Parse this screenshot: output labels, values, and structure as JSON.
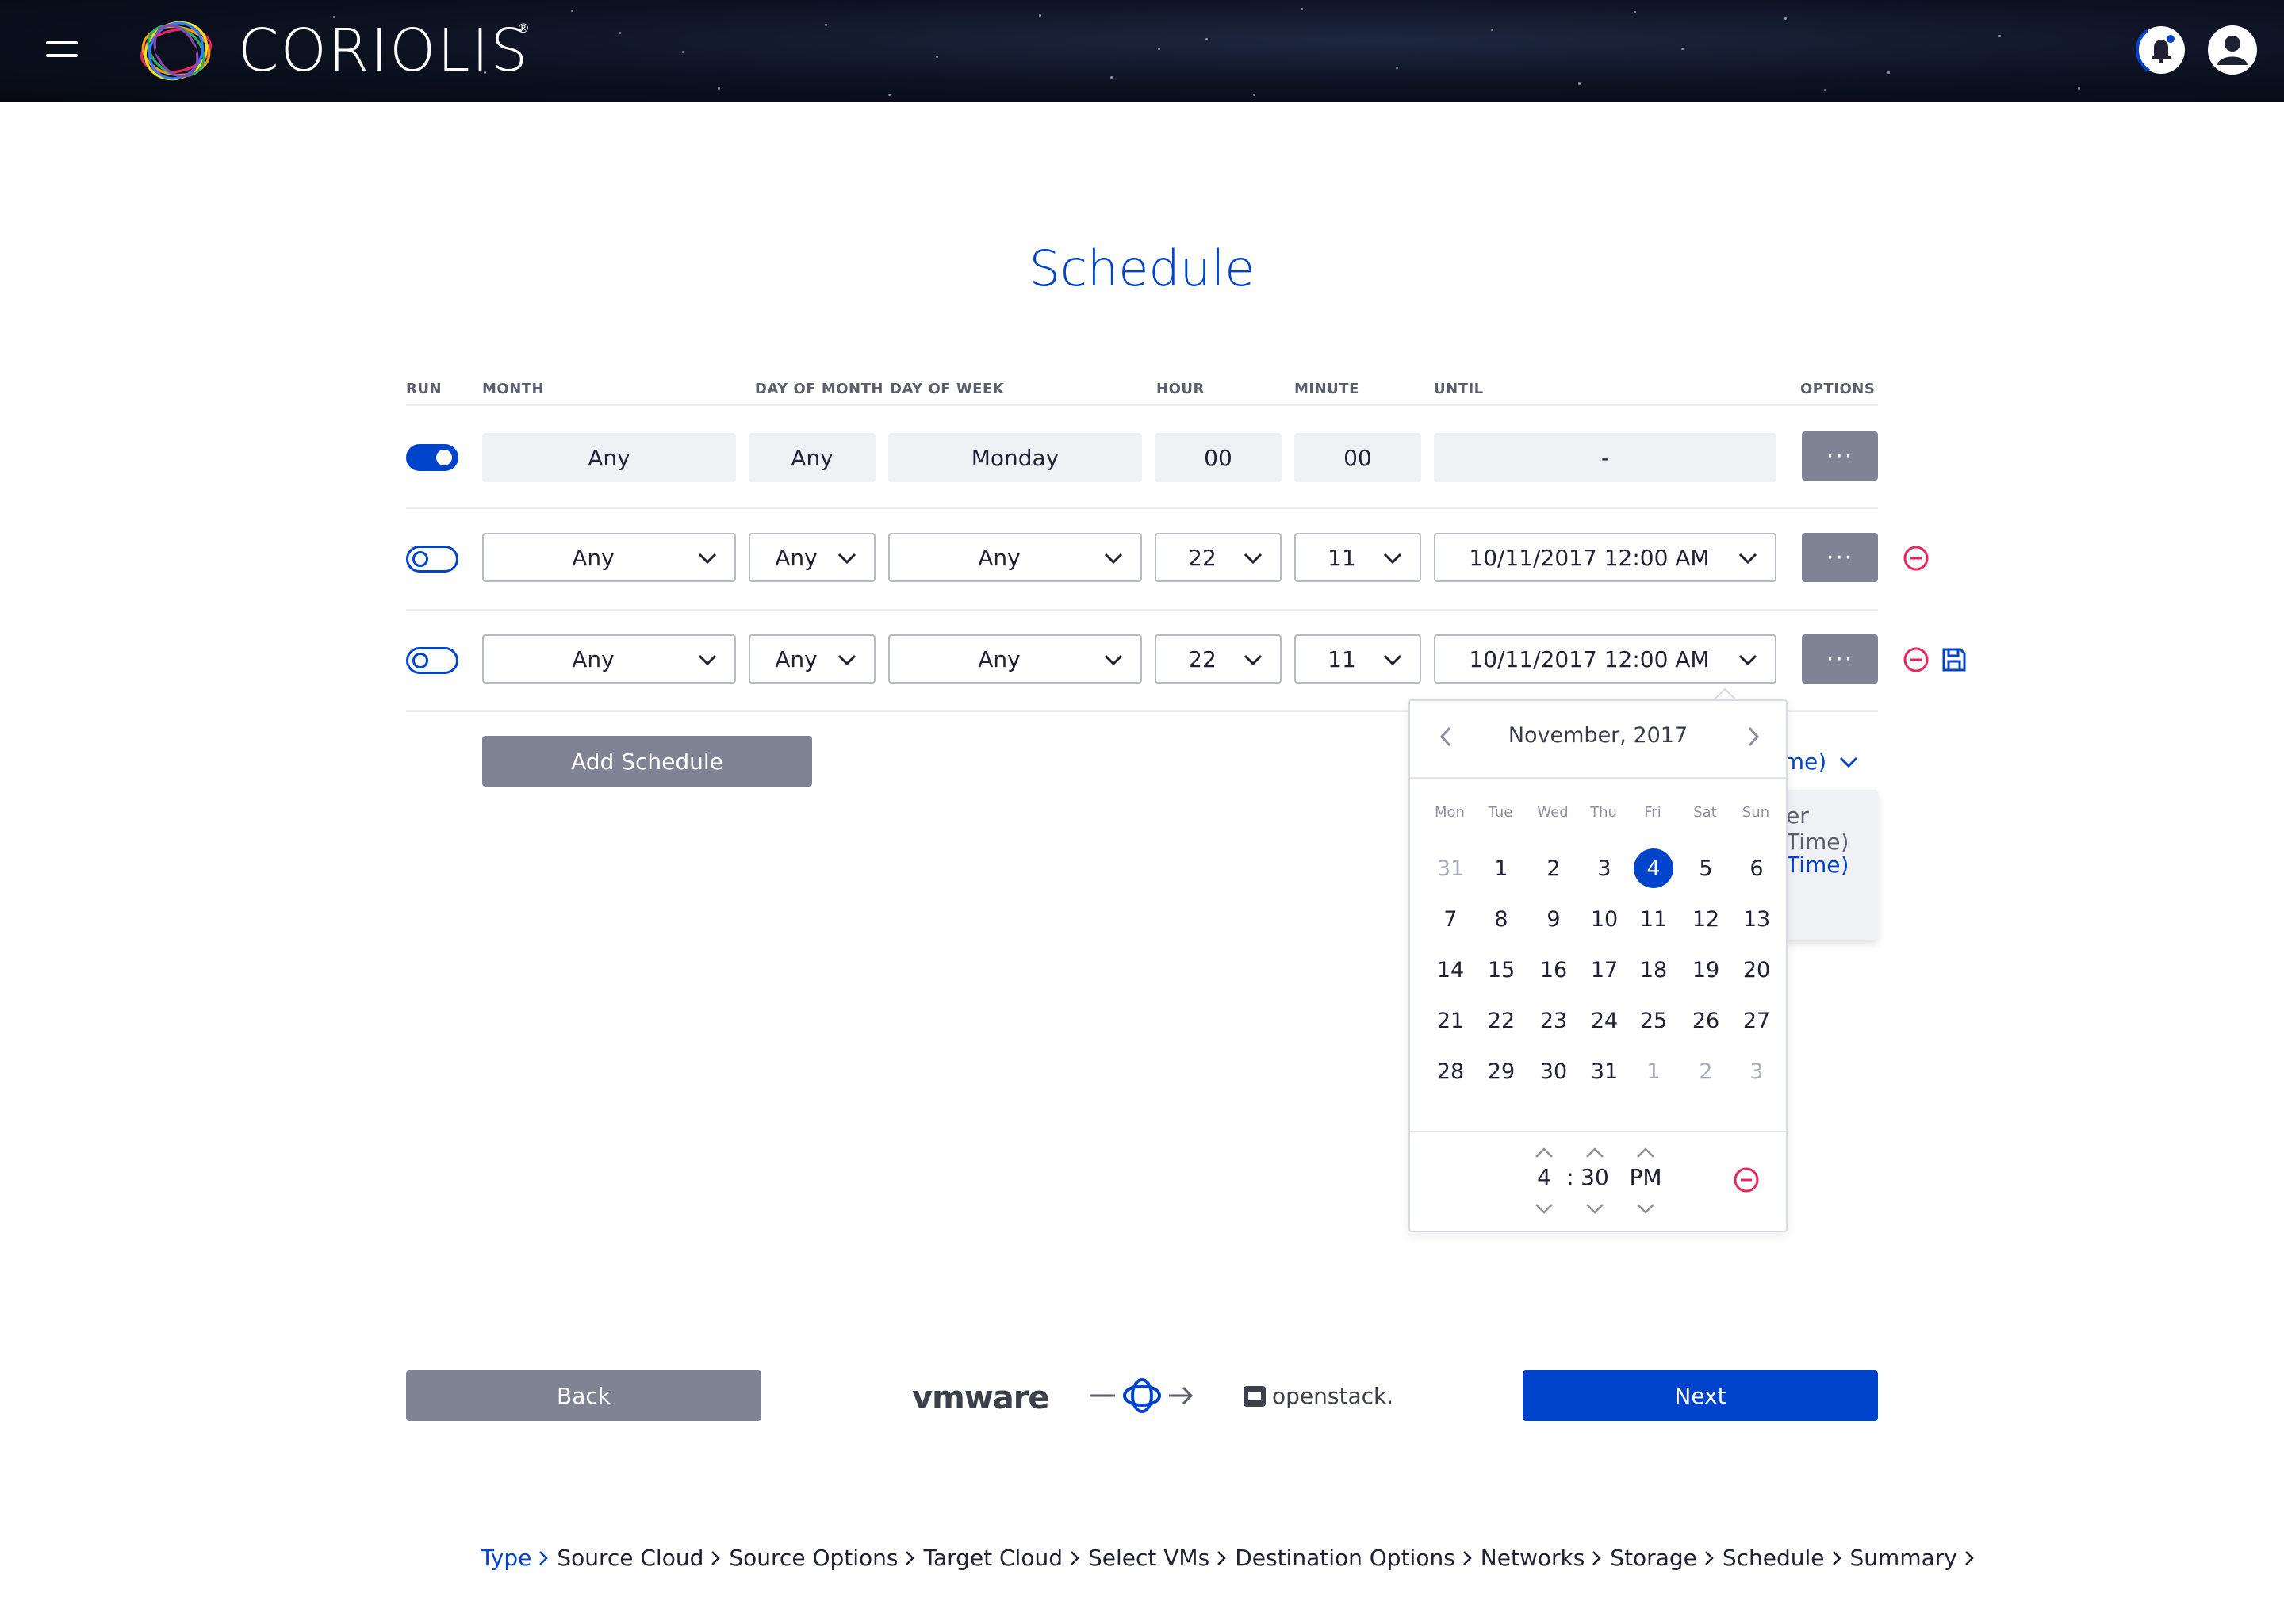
{
  "app": {
    "logo_text": "CORIOLIS",
    "logo_reg": "®"
  },
  "page": {
    "title": "Schedule"
  },
  "table": {
    "headers": {
      "run": "RUN",
      "month": "MONTH",
      "day_of_month": "DAY OF MONTH",
      "day_of_week": "DAY OF WEEK",
      "hour": "HOUR",
      "minute": "MINUTE",
      "until": "UNTIL",
      "options": "OPTIONS"
    },
    "rows": [
      {
        "run_on": true,
        "month": "Any",
        "day_of_month": "Any",
        "day_of_week": "Monday",
        "hour": "00",
        "minute": "00",
        "until": "-",
        "options_label": "···"
      },
      {
        "run_on": false,
        "month": "Any",
        "day_of_month": "Any",
        "day_of_week": "Any",
        "hour": "22",
        "minute": "11",
        "until": "10/11/2017 12:00 AM",
        "options_label": "···"
      },
      {
        "run_on": false,
        "month": "Any",
        "day_of_month": "Any",
        "day_of_week": "Any",
        "hour": "22",
        "minute": "11",
        "until": "10/11/2017 12:00 AM",
        "options_label": "···"
      }
    ],
    "add_schedule_label": "Add Schedule"
  },
  "timezone": {
    "link_fragment": "ime)",
    "option1_fragment": "er Time)",
    "option2_fragment": "Time)"
  },
  "datepicker": {
    "month_label": "November, 2017",
    "weekdays": [
      "Mon",
      "Tue",
      "Wed",
      "Thu",
      "Fri",
      "Sat",
      "Sun"
    ],
    "weeks": [
      [
        "31",
        "1",
        "2",
        "3",
        "4",
        "5",
        "6"
      ],
      [
        "7",
        "8",
        "9",
        "10",
        "11",
        "12",
        "13"
      ],
      [
        "14",
        "15",
        "16",
        "17",
        "18",
        "19",
        "20"
      ],
      [
        "21",
        "22",
        "23",
        "24",
        "25",
        "26",
        "27"
      ],
      [
        "28",
        "29",
        "30",
        "31",
        "1",
        "2",
        "3"
      ]
    ],
    "muted_first_week": [
      "31"
    ],
    "muted_last_week": [
      "1",
      "2",
      "3"
    ],
    "selected_day": "4",
    "time": {
      "hour": "4",
      "separator": ":",
      "minute": "30",
      "ampm": "PM"
    }
  },
  "footer": {
    "back_label": "Back",
    "next_label": "Next",
    "source_logo_text": "vmware",
    "target_logo_text": "openstack."
  },
  "breadcrumbs": [
    "Type",
    "Source Cloud",
    "Source Options",
    "Target Cloud",
    "Select VMs",
    "Destination Options",
    "Networks",
    "Storage",
    "Schedule",
    "Summary"
  ],
  "colors": {
    "accent": "#0044cb",
    "button_gray": "#7f8393",
    "danger": "#e9265e",
    "header_bg": "#0c1120"
  }
}
